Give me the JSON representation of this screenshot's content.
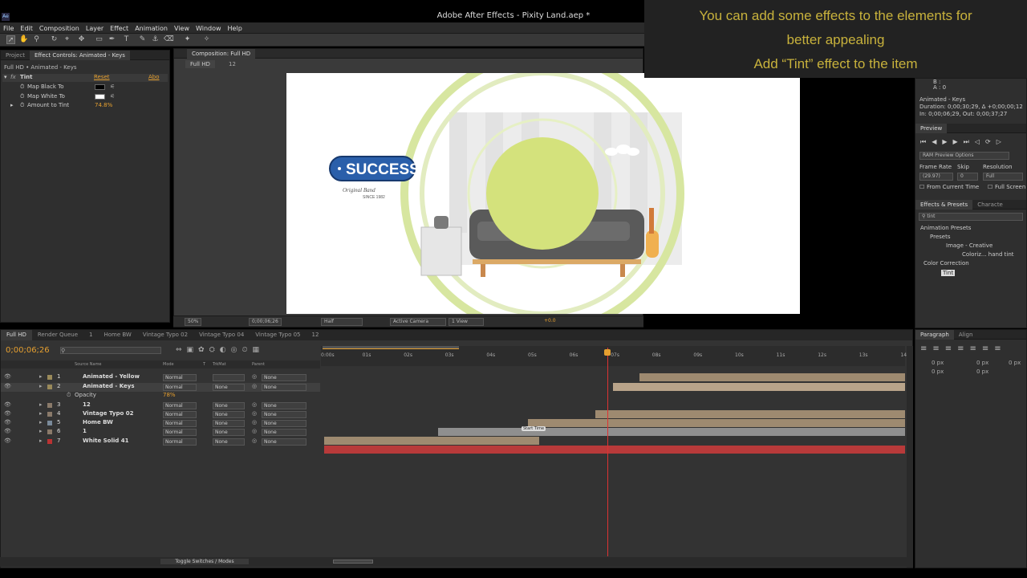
{
  "app": {
    "title": "Adobe After Effects - Pixity Land.aep *",
    "icon_label": "Ae"
  },
  "menu": [
    "File",
    "Edit",
    "Composition",
    "Layer",
    "Effect",
    "Animation",
    "View",
    "Window",
    "Help"
  ],
  "tooltip": {
    "line1": "You can add some effects to the elements for",
    "line2": "better appealing",
    "line3": "Add “Tint” effect to the item"
  },
  "left_panel": {
    "tabs": [
      "Project",
      "Effect Controls: Animated - Keys"
    ],
    "path": "Full HD • Animated - Keys",
    "effect_name": "Tint",
    "reset": "Reset",
    "about": "Abo",
    "props": [
      {
        "label": "Map Black To"
      },
      {
        "label": "Map White To"
      },
      {
        "label": "Amount to Tint",
        "value": "74.8%"
      }
    ]
  },
  "composition": {
    "tab": "Composition: Full HD",
    "sub_tabs": [
      "Full HD",
      "12"
    ],
    "zoom": "50%",
    "time": "0;00;06;26",
    "resolution": "Half",
    "camera": "Active Camera",
    "view": "1 View",
    "exposure": "+0.0",
    "badge_text": "SUCCESS",
    "badge_sub": "Original Band",
    "badge_since": "SINCE 1982"
  },
  "info_panel": {
    "b": "B :",
    "a": "A : 0",
    "layer": "Animated - Keys",
    "duration": "Duration: 0;00;30;29, Δ +0;00;00;12",
    "inout": "In: 0;00;06;29, Out: 0;00;37;27"
  },
  "preview_panel": {
    "title": "Preview",
    "ram": "RAM Preview Options",
    "frame_rate_label": "Frame Rate",
    "skip_label": "Skip",
    "resolution_label": "Resolution",
    "frame_rate": "(29.97)",
    "skip": "0",
    "resolution": "Full",
    "from_current": "From Current Time",
    "full_screen": "Full Screen"
  },
  "effects_panel": {
    "tabs": [
      "Effects & Presets",
      "Characte"
    ],
    "search": "tint",
    "tree": [
      "Animation Presets",
      "Presets",
      "Image - Creative",
      "Coloriz... hand tint",
      "Color Correction",
      "Tint"
    ]
  },
  "timeline": {
    "tabs": [
      "Full HD",
      "Render Queue",
      "1",
      "Home BW",
      "Vintage Typo 02",
      "Vintage Typo 04",
      "Vintage Typo 05",
      "12"
    ],
    "timecode": "0;00;06;26",
    "columns": [
      "Source Name",
      "Mode",
      "T",
      "TrkMat",
      "Parent"
    ],
    "ruler": [
      "0:00s",
      "01s",
      "02s",
      "03s",
      "04s",
      "05s",
      "06s",
      "07s",
      "08s",
      "09s",
      "10s",
      "11s",
      "12s",
      "13s",
      "14s"
    ],
    "layers": [
      {
        "num": "1",
        "name": "Animated - Yellow",
        "mode": "Normal",
        "trkmat": "",
        "parent": "None"
      },
      {
        "num": "2",
        "name": "Animated - Keys",
        "mode": "Normal",
        "trkmat": "None",
        "parent": "None"
      },
      {
        "num": "3",
        "name": "12",
        "mode": "Normal",
        "trkmat": "None",
        "parent": "None"
      },
      {
        "num": "4",
        "name": "Vintage Typo 02",
        "mode": "Normal",
        "trkmat": "None",
        "parent": "None"
      },
      {
        "num": "5",
        "name": "Home BW",
        "mode": "Normal",
        "trkmat": "None",
        "parent": "None"
      },
      {
        "num": "6",
        "name": "1",
        "mode": "Normal",
        "trkmat": "None",
        "parent": "None"
      },
      {
        "num": "7",
        "name": "White Solid 41",
        "mode": "Normal",
        "trkmat": "None",
        "parent": "None"
      }
    ],
    "opacity_label": "Opacity",
    "opacity_value": "78%",
    "marker": "Start Time",
    "toggle": "Toggle Switches / Modes"
  },
  "paragraph_panel": {
    "tabs": [
      "Paragraph",
      "Align"
    ],
    "px": [
      "0 px",
      "0 px",
      "0 px",
      "0 px",
      "0 px"
    ]
  }
}
